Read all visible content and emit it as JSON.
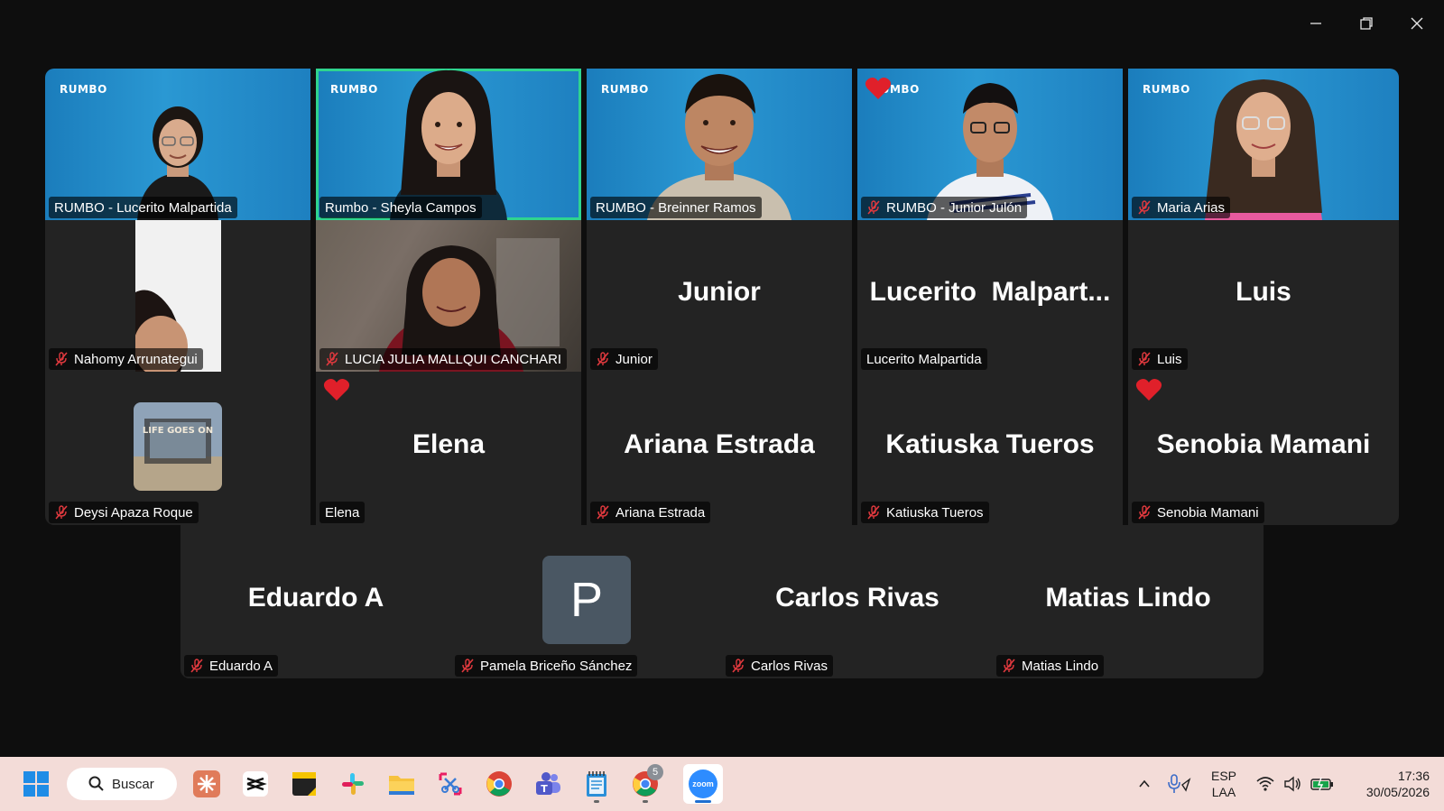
{
  "window": {
    "controls": {
      "minimize": "minimize-icon",
      "restore": "restore-icon",
      "close": "close-icon"
    }
  },
  "gallery": {
    "brand_label": "RUMBO",
    "row1": [
      {
        "name": "RUMBO - Lucerito Malpartida",
        "muted": false
      },
      {
        "name": "Rumbo - Sheyla Campos",
        "muted": false,
        "active_speaker": true
      },
      {
        "name": "RUMBO - Breinner Ramos",
        "muted": false
      },
      {
        "name": "RUMBO - Junior Julón",
        "muted": true,
        "reaction": "heart"
      },
      {
        "name": "Maria Arias",
        "muted": true
      }
    ],
    "row2": [
      {
        "name": "Nahomy Arrunategui",
        "muted": true
      },
      {
        "name": "LUCIA JULIA MALLQUI CANCHARI",
        "muted": true
      },
      {
        "display": "Junior",
        "name": "Junior",
        "muted": true
      },
      {
        "display": "Lucerito  Malpart...",
        "name": "Lucerito Malpartida",
        "muted": false
      },
      {
        "display": "Luis",
        "name": "Luis",
        "muted": true
      }
    ],
    "row3": [
      {
        "name": "Deysi Apaza Roque",
        "muted": true,
        "avatar_text": "LIFE GOES ON"
      },
      {
        "display": "Elena",
        "name": "Elena",
        "muted": false,
        "reaction": "heart"
      },
      {
        "display": "Ariana Estrada",
        "name": "Ariana Estrada",
        "muted": true
      },
      {
        "display": "Katiuska Tueros",
        "name": "Katiuska Tueros",
        "muted": true
      },
      {
        "display": "Senobia Mamani",
        "name": "Senobia Mamani",
        "muted": true,
        "reaction": "heart"
      }
    ],
    "row4": [
      {
        "display": "Eduardo A",
        "name": "Eduardo A",
        "muted": true
      },
      {
        "initial": "P",
        "name": "Pamela Briceño Sánchez",
        "muted": true
      },
      {
        "display": "Carlos Rivas",
        "name": "Carlos Rivas",
        "muted": true
      },
      {
        "display": "Matias Lindo",
        "name": "Matias Lindo",
        "muted": true
      }
    ]
  },
  "taskbar": {
    "search_label": "Buscar",
    "badge_count": "5",
    "apps": [
      "windows-start",
      "search",
      "claude",
      "capcut",
      "sticky-notes",
      "slack",
      "file-explorer",
      "snipping-tool",
      "chrome",
      "teams",
      "notepad",
      "chrome-profile",
      "zoom"
    ],
    "zoom_label": "zoom",
    "language": "ESP",
    "layout": "LAA",
    "time": "17:36",
    "date": "30/05/2026"
  },
  "colors": {
    "tile_bg": "#232323",
    "active_border": "#2fd48f",
    "mute_red": "#e0393e",
    "taskbar_bg": "#f3dcd8"
  }
}
